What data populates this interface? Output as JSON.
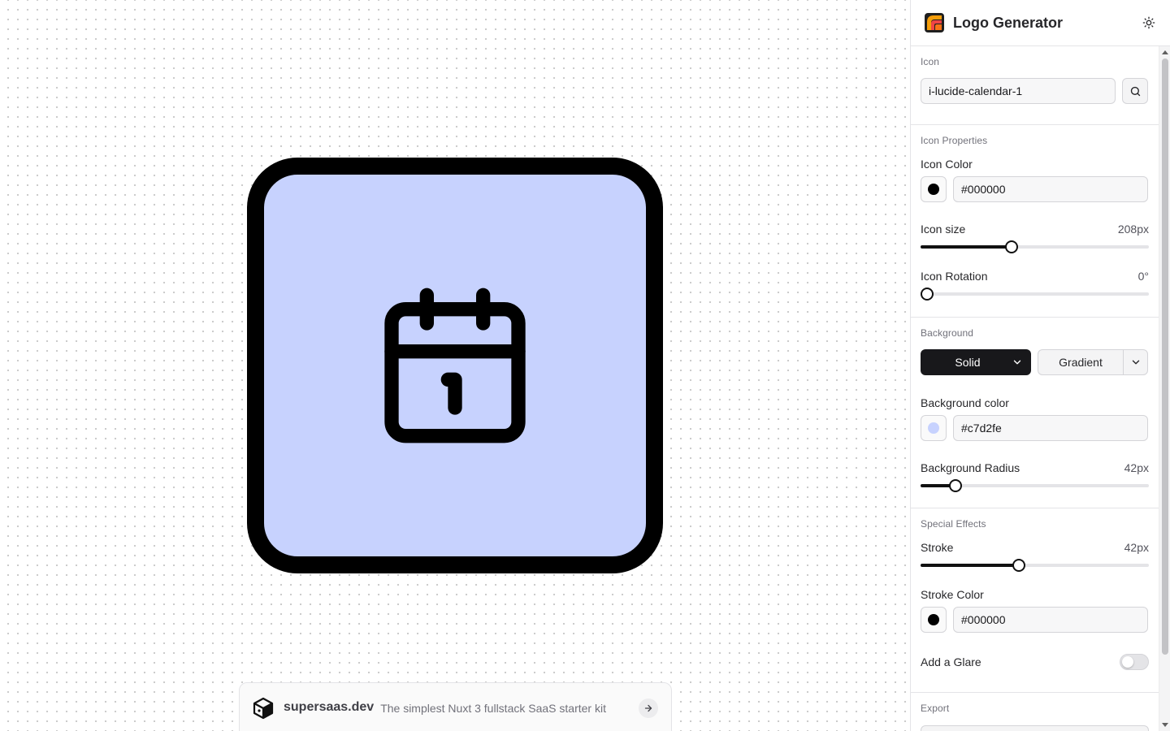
{
  "app": {
    "title": "Logo Generator"
  },
  "preview": {
    "background_color": "#c7d2fe",
    "stroke_color": "#000000",
    "icon_color": "#000000",
    "icon_text": "1"
  },
  "promo": {
    "brand": "supersaas.dev",
    "tagline": "The simplest Nuxt 3 fullstack SaaS starter kit"
  },
  "icon_section": {
    "title": "Icon",
    "value": "i-lucide-calendar-1"
  },
  "icon_properties": {
    "title": "Icon Properties",
    "color_label": "Icon Color",
    "color_value": "#000000",
    "size_label": "Icon size",
    "size_value": "208px",
    "size_fraction": 0.393,
    "rotation_label": "Icon Rotation",
    "rotation_value": "0°",
    "rotation_fraction": 0.0
  },
  "background": {
    "title": "Background",
    "solid_label": "Solid",
    "gradient_label": "Gradient",
    "color_label": "Background color",
    "color_value": "#c7d2fe",
    "radius_label": "Background Radius",
    "radius_value": "42px",
    "radius_fraction": 0.132
  },
  "effects": {
    "title": "Special Effects",
    "stroke_label": "Stroke",
    "stroke_value": "42px",
    "stroke_fraction": 0.425,
    "stroke_color_label": "Stroke Color",
    "stroke_color_value": "#000000",
    "glare_label": "Add a Glare",
    "glare_on": false
  },
  "export": {
    "title": "Export"
  },
  "icons": {
    "theme": "sun-icon",
    "search": "search-icon",
    "chevron": "chevron-down-icon",
    "cube": "cube-icon",
    "arrow": "arrow-right-icon",
    "calendar": "calendar-icon"
  }
}
